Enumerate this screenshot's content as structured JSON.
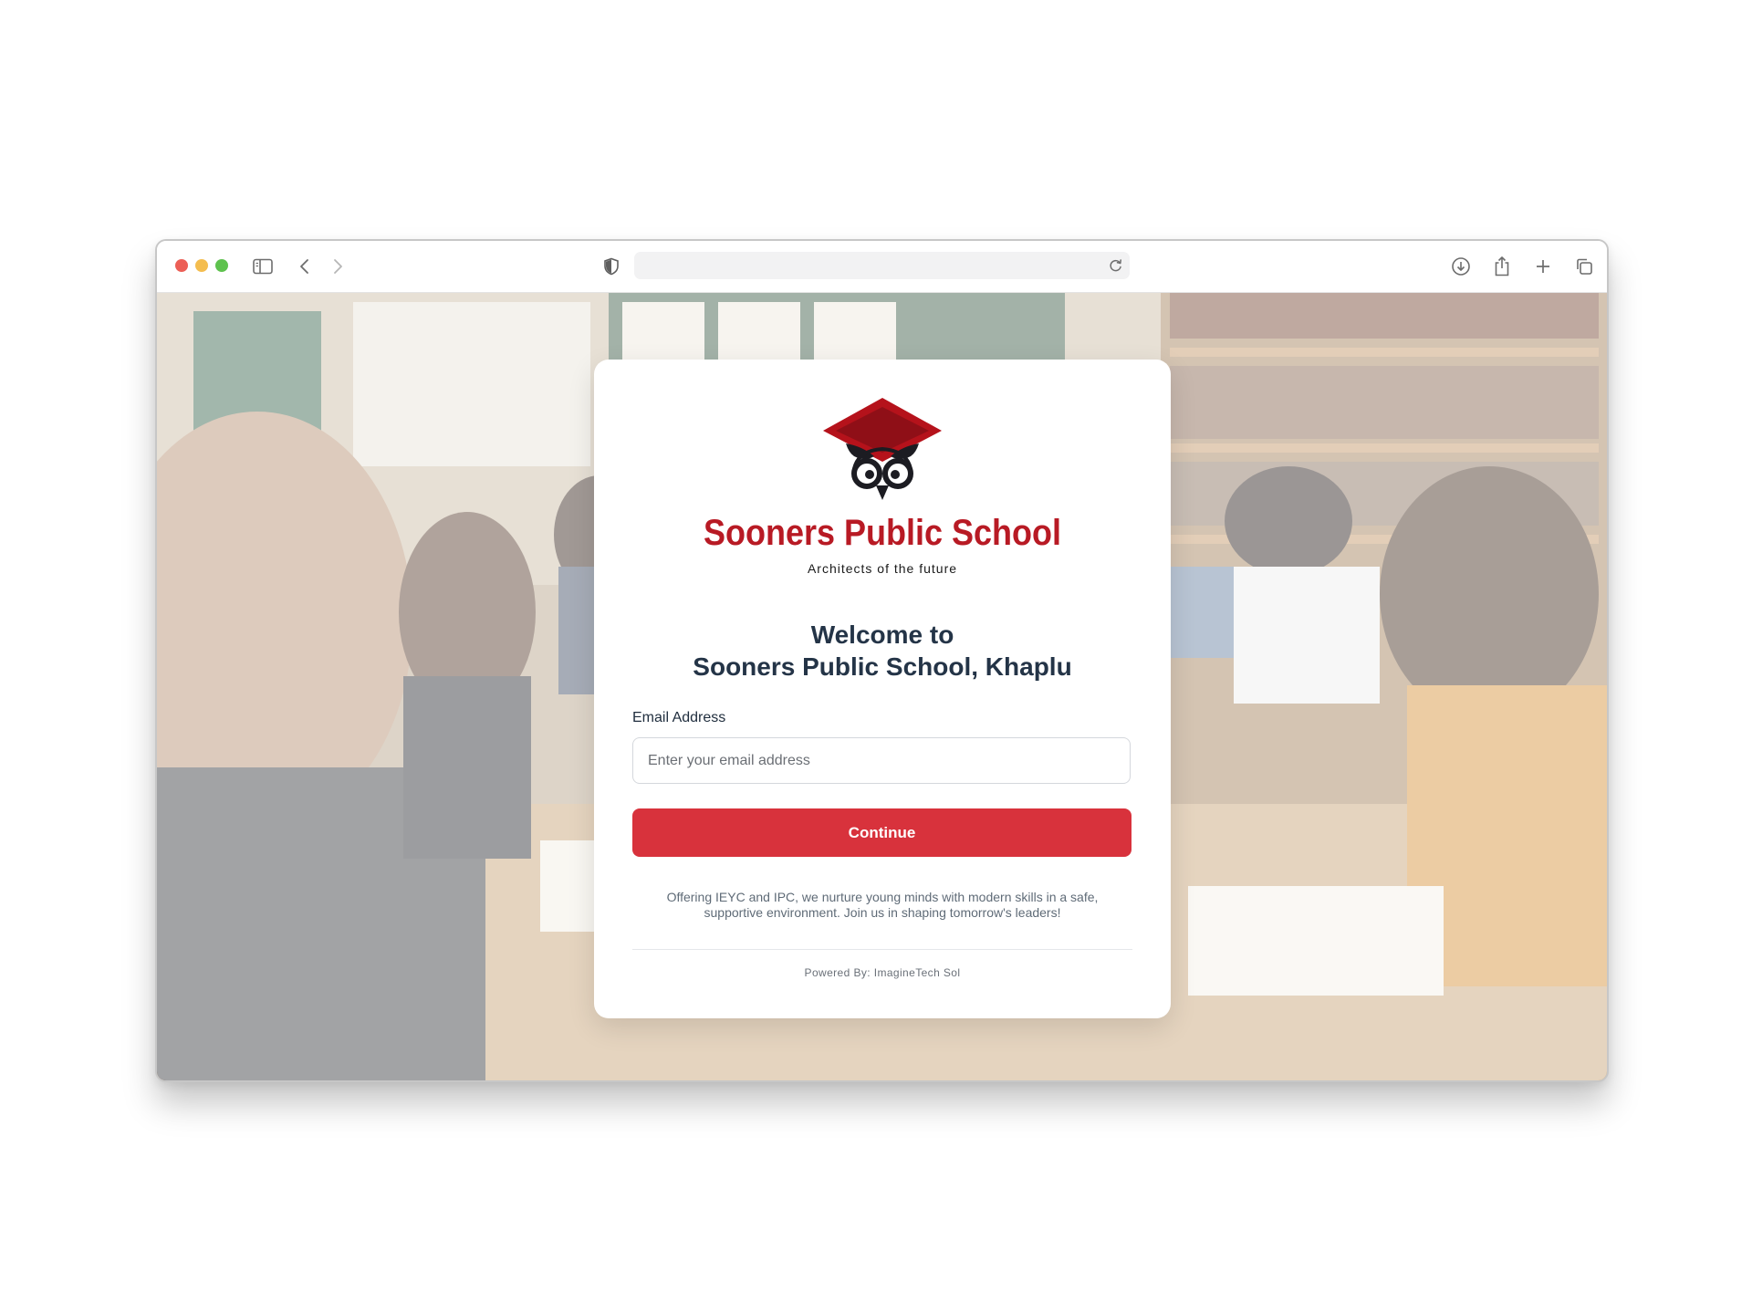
{
  "browser": {
    "url": "",
    "icons": {
      "sidebar": "sidebar-icon",
      "back": "chevron-left-icon",
      "forward": "chevron-right-icon",
      "privacy": "shield-icon",
      "reload": "reload-icon",
      "download": "download-icon",
      "share": "share-icon",
      "new_tab": "plus-icon",
      "tabs": "tabs-overview-icon"
    }
  },
  "school": {
    "name": "Sooners Public School",
    "tagline": "Architects of the future",
    "logo": "graduation-cap-owl-logo"
  },
  "welcome": {
    "line1": "Welcome to",
    "line2": "Sooners Public School, Khaplu"
  },
  "form": {
    "email_label": "Email Address",
    "email_placeholder": "Enter your email address",
    "email_value": "",
    "continue_label": "Continue"
  },
  "description": "Offering IEYC and IPC, we nurture young minds with modern skills in a safe, supportive environment. Join us in shaping tomorrow's leaders!",
  "footer": {
    "powered_by": "Powered By: ImagineTech Sol"
  },
  "colors": {
    "brand_red": "#b81a24",
    "button_red": "#d8323c",
    "heading": "#243447",
    "close_dot": "#ec5f56",
    "minimize_dot": "#f4bd4f",
    "zoom_dot": "#5ec24e"
  }
}
